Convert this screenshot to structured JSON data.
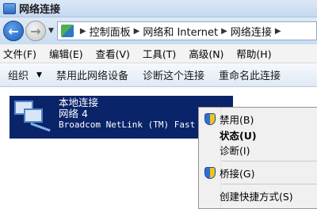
{
  "window": {
    "title": "网络连接"
  },
  "address": {
    "crumbs": [
      "控制面板",
      "网络和 Internet",
      "网络连接"
    ]
  },
  "menubar": {
    "items": [
      "文件(F)",
      "编辑(E)",
      "查看(V)",
      "工具(T)",
      "高级(N)",
      "帮助(H)"
    ]
  },
  "toolbar": {
    "organize": "组织",
    "disable": "禁用此网络设备",
    "diagnose": "诊断这个连接",
    "rename": "重命名此连接"
  },
  "connection": {
    "name": "本地连接",
    "status": "网络  4",
    "device": "Broadcom NetLink (TM) Fast"
  },
  "context_menu": {
    "items": [
      {
        "label": "禁用(B)",
        "icon": "shield-icon",
        "bold": false
      },
      {
        "label": "状态(U)",
        "icon": "",
        "bold": true
      },
      {
        "label": "诊断(I)",
        "icon": "",
        "bold": false
      },
      {
        "label": "桥接(G)",
        "icon": "shield-icon",
        "bold": false
      },
      {
        "label": "创建快捷方式(S)",
        "icon": "",
        "bold": false
      }
    ]
  },
  "colors": {
    "selection": "#0a246a",
    "titlebar": "#dbe8f6",
    "menu_bg": "#f0f0f0"
  }
}
